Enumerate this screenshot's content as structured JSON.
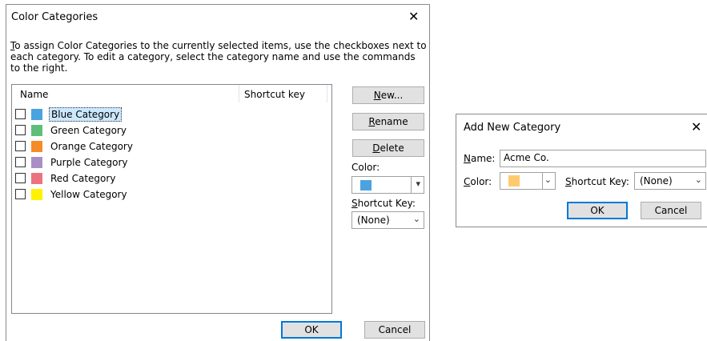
{
  "dialog1": {
    "title": "Color Categories",
    "close_glyph": "✕",
    "description_first_char": "T",
    "description_rest": "o assign Color Categories to the currently selected items, use the checkboxes next to each category.  To edit a category, select the category name and use the commands to the right.",
    "columns": {
      "name": "Name",
      "shortcut": "Shortcut key"
    },
    "categories": [
      {
        "label": "Blue Category",
        "color": "#4aa3df",
        "checked": false,
        "selected": true
      },
      {
        "label": "Green Category",
        "color": "#5fbf7a",
        "checked": false,
        "selected": false
      },
      {
        "label": "Orange Category",
        "color": "#f68b2a",
        "checked": false,
        "selected": false
      },
      {
        "label": "Purple Category",
        "color": "#a98ec6",
        "checked": false,
        "selected": false
      },
      {
        "label": "Red Category",
        "color": "#ec7280",
        "checked": false,
        "selected": false
      },
      {
        "label": "Yellow Category",
        "color": "#fff200",
        "checked": false,
        "selected": false
      }
    ],
    "buttons": {
      "new_first": "N",
      "new_rest": "ew...",
      "rename_first": "R",
      "rename_rest": "ename",
      "delete_first": "D",
      "delete_rest": "elete",
      "ok": "OK",
      "cancel": "Cancel"
    },
    "color_label": "Color:",
    "color_value": "#4aa3df",
    "shortcut_label_first": "S",
    "shortcut_label_rest": "hortcut Key:",
    "shortcut_value": "(None)"
  },
  "dialog2": {
    "title": "Add New Category",
    "close_glyph": "✕",
    "name_label_first": "N",
    "name_label_rest": "ame:",
    "name_value": "Acme Co.",
    "color_label_first": "C",
    "color_label_rest": "olor:",
    "color_value": "#ffca6e",
    "shortcut_label_first": "S",
    "shortcut_label_rest": "hortcut Key:",
    "shortcut_value": "(None)",
    "ok": "OK",
    "cancel": "Cancel"
  },
  "icons": {
    "chevron": "chevron-down-icon",
    "close": "close-icon"
  }
}
